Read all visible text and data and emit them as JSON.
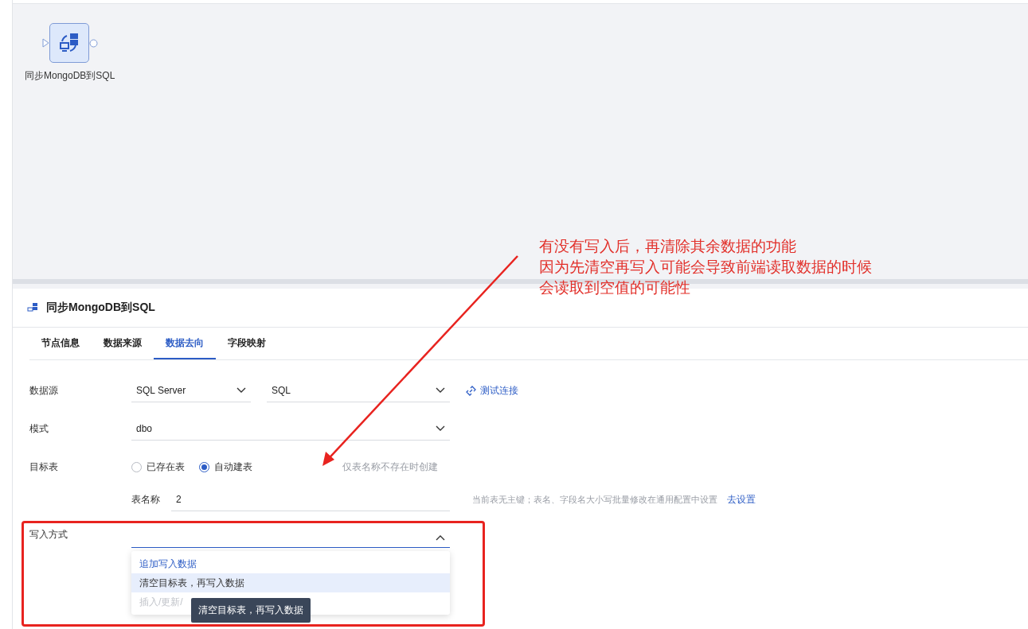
{
  "canvas": {
    "node": {
      "label": "同步MongoDB到SQL"
    }
  },
  "panel": {
    "title": "同步MongoDB到SQL",
    "tabs": [
      {
        "label": "节点信息",
        "selected": false
      },
      {
        "label": "数据来源",
        "selected": false
      },
      {
        "label": "数据去向",
        "selected": true
      },
      {
        "label": "字段映射",
        "selected": false
      }
    ]
  },
  "form": {
    "datasource": {
      "label": "数据源",
      "type": "SQL Server",
      "database": "SQL",
      "test_link": "测试连接"
    },
    "schema": {
      "label": "模式",
      "value": "dbo"
    },
    "target_table": {
      "label": "目标表",
      "options": [
        {
          "label": "已存在表",
          "selected": false
        },
        {
          "label": "自动建表",
          "selected": true
        }
      ],
      "hint": "仅表名称不存在时创建",
      "table_name": {
        "label": "表名称",
        "value": "2"
      },
      "note": "当前表无主键；表名、字段名大小写批量修改在通用配置中设置",
      "note_link": "去设置"
    },
    "write_mode": {
      "label": "写入方式",
      "expanded": true,
      "options": [
        {
          "label": "追加写入数据",
          "selected": true,
          "hovered": false,
          "disabled": false
        },
        {
          "label": "清空目标表，再写入数据",
          "selected": false,
          "hovered": true,
          "disabled": false
        },
        {
          "label": "插入/更新/",
          "selected": false,
          "hovered": false,
          "disabled": true
        }
      ],
      "tooltip": "清空目标表，再写入数据"
    }
  },
  "annotation": {
    "lines": [
      "有没有写入后，再清除其余数据的功能",
      "因为先清空再写入可能会导致前端读取数据的时候",
      "会读取到空值的可能性"
    ]
  }
}
